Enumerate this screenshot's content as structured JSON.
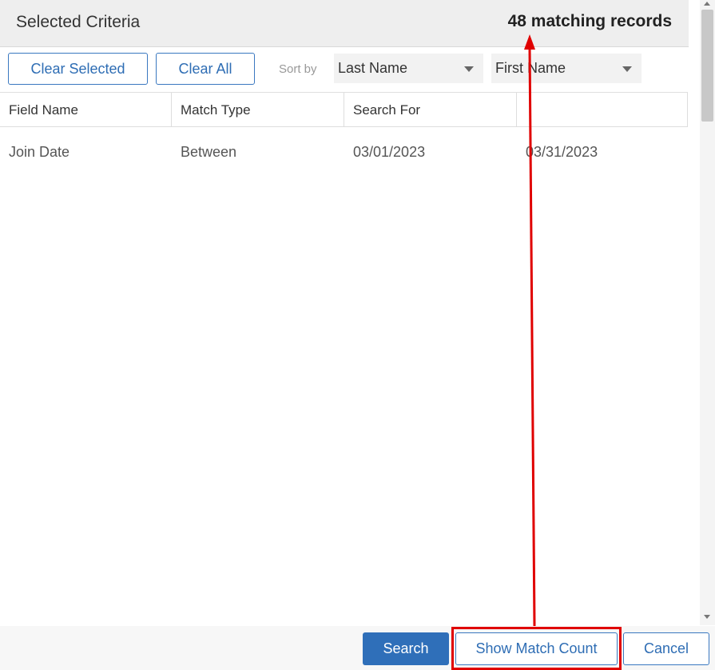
{
  "header": {
    "title": "Selected Criteria",
    "match_count": "48 matching records"
  },
  "toolbar": {
    "clear_selected_label": "Clear Selected",
    "clear_all_label": "Clear All",
    "sort_by_label": "Sort by",
    "sort_primary": "Last Name",
    "sort_secondary": "First Name"
  },
  "table": {
    "columns": [
      "Field Name",
      "Match Type",
      "Search For",
      ""
    ],
    "rows": [
      [
        "Join Date",
        "Between",
        "03/01/2023",
        "03/31/2023"
      ]
    ]
  },
  "footer": {
    "search_label": "Search",
    "show_match_count_label": "Show Match Count",
    "cancel_label": "Cancel"
  },
  "colors": {
    "accent": "#2f6fb9",
    "annotation": "#e00000",
    "header_bg": "#eeeeee"
  }
}
